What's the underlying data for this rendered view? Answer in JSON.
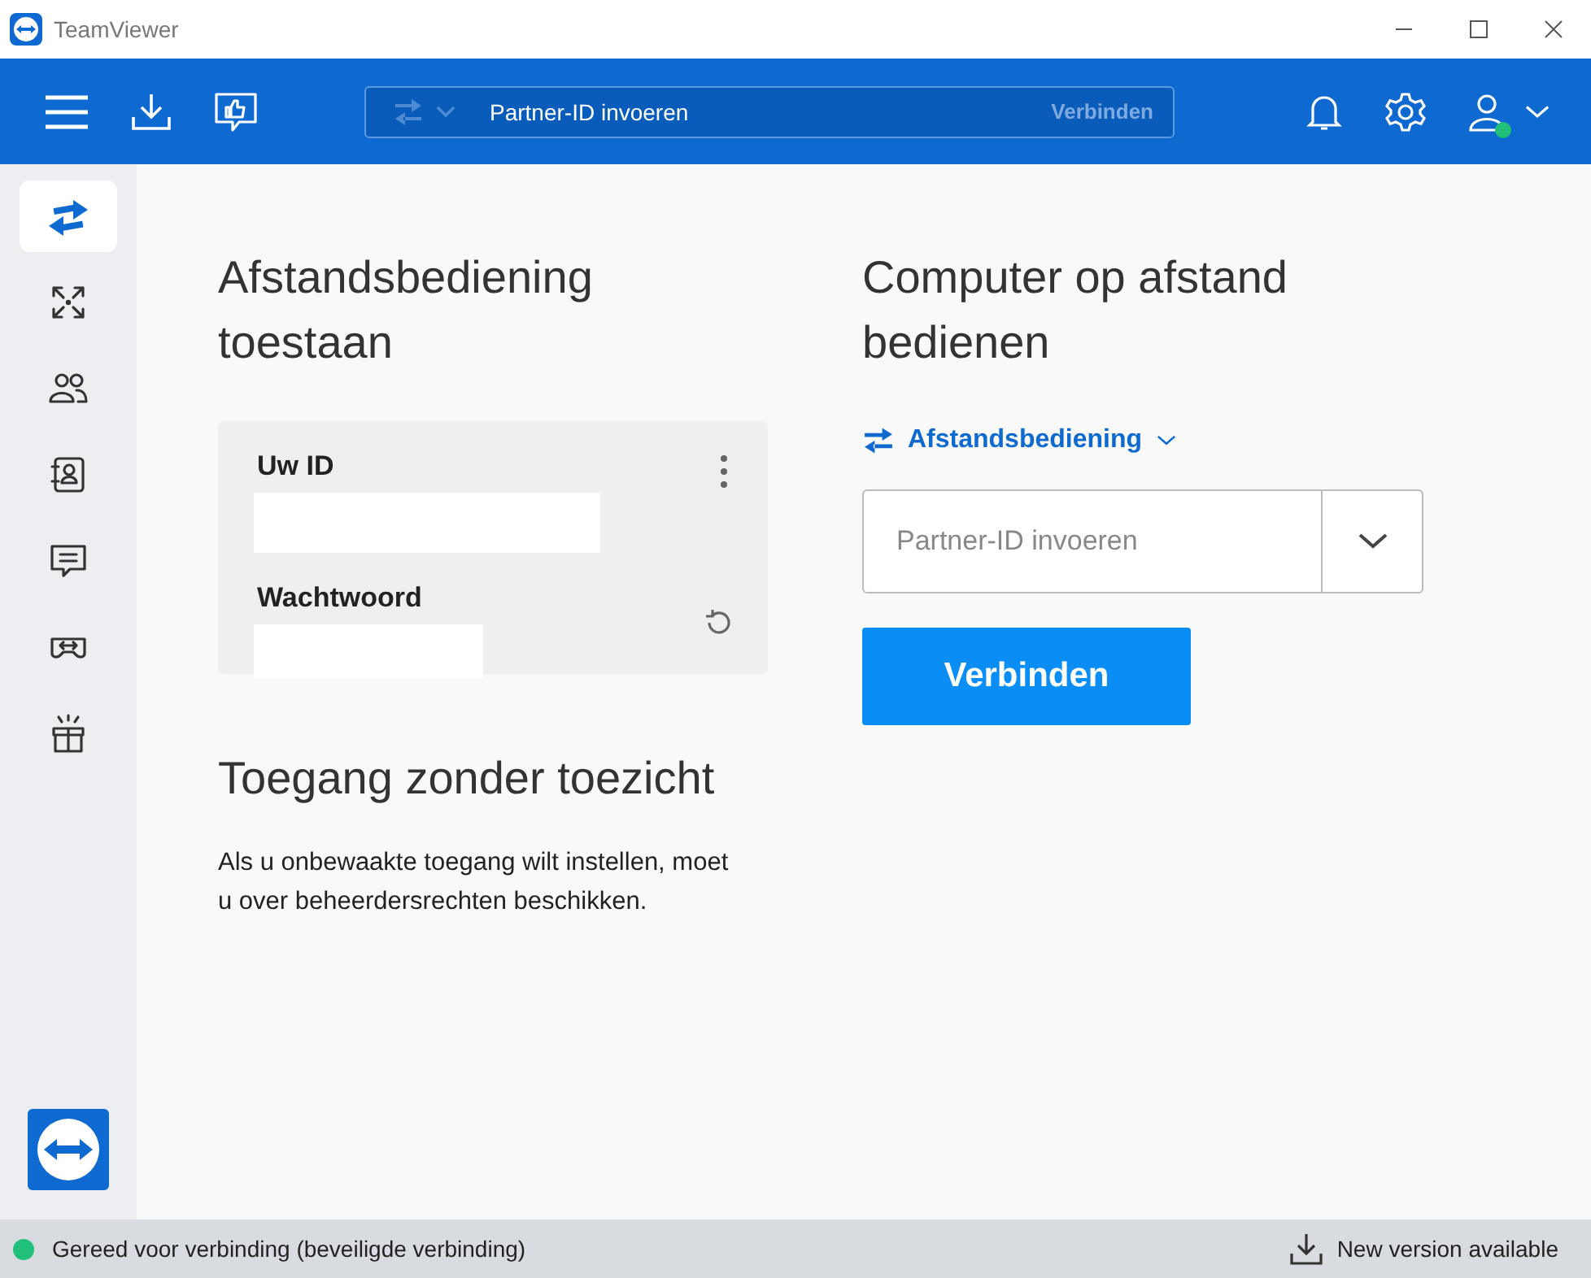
{
  "window": {
    "title": "TeamViewer"
  },
  "toolbar": {
    "partner_placeholder": "Partner-ID invoeren",
    "connect_label": "Verbinden"
  },
  "sidebar": {
    "items": [
      {
        "kind": "remote",
        "selected": true
      },
      {
        "kind": "meeting",
        "selected": false
      },
      {
        "kind": "people",
        "selected": false
      },
      {
        "kind": "contacts",
        "selected": false
      },
      {
        "kind": "chat",
        "selected": false
      },
      {
        "kind": "headset",
        "selected": false
      },
      {
        "kind": "gift",
        "selected": false
      }
    ]
  },
  "allow": {
    "title": "Afstandsbediening toestaan",
    "id_label": "Uw ID",
    "password_label": "Wachtwoord"
  },
  "unattended": {
    "title": "Toegang zonder toezicht",
    "text": "Als u onbewaakte toegang wilt instellen, moet u over beheerdersrechten beschikken."
  },
  "control": {
    "title": "Computer op afstand bedienen",
    "mode": "Afstandsbediening",
    "placeholder": "Partner-ID invoeren",
    "button": "Verbinden"
  },
  "status_bar": {
    "text": "Gereed voor verbinding (beveiligde verbinding)",
    "update": "New version available"
  }
}
